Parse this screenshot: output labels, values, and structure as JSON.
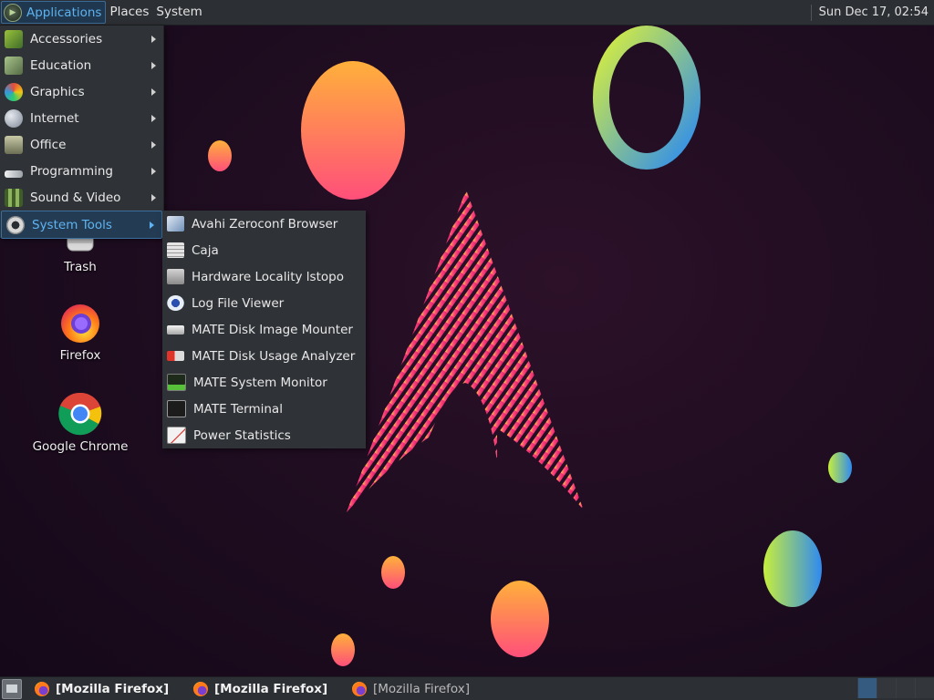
{
  "top_panel": {
    "applications_label": "Applications",
    "places_label": "Places",
    "system_label": "System",
    "clock": "Sun Dec 17, 02:54"
  },
  "app_menu": {
    "items": [
      {
        "label": "Accessories",
        "icon": "accessories-icon"
      },
      {
        "label": "Education",
        "icon": "education-icon"
      },
      {
        "label": "Graphics",
        "icon": "graphics-icon"
      },
      {
        "label": "Internet",
        "icon": "internet-icon"
      },
      {
        "label": "Office",
        "icon": "office-icon"
      },
      {
        "label": "Programming",
        "icon": "programming-icon"
      },
      {
        "label": "Sound & Video",
        "icon": "sound-video-icon"
      },
      {
        "label": "System Tools",
        "icon": "system-tools-icon",
        "active": true
      }
    ]
  },
  "system_tools_menu": {
    "items": [
      {
        "label": "Avahi Zeroconf Browser",
        "icon": "avahi-icon"
      },
      {
        "label": "Caja",
        "icon": "caja-icon"
      },
      {
        "label": "Hardware Locality lstopo",
        "icon": "hardware-icon"
      },
      {
        "label": "Log File Viewer",
        "icon": "log-viewer-icon"
      },
      {
        "label": "MATE Disk Image Mounter",
        "icon": "disk-mounter-icon"
      },
      {
        "label": "MATE Disk Usage Analyzer",
        "icon": "disk-usage-icon"
      },
      {
        "label": "MATE System Monitor",
        "icon": "system-monitor-icon"
      },
      {
        "label": "MATE Terminal",
        "icon": "terminal-icon"
      },
      {
        "label": "Power Statistics",
        "icon": "power-stats-icon"
      }
    ]
  },
  "desktop_icons": [
    {
      "label": "Trash",
      "icon": "trash-icon"
    },
    {
      "label": "Firefox",
      "icon": "firefox-icon"
    },
    {
      "label": "Google Chrome",
      "icon": "chrome-icon"
    }
  ],
  "taskbar": {
    "tasks": [
      {
        "label": "[Mozilla Firefox]",
        "state": "active"
      },
      {
        "label": "[Mozilla Firefox]",
        "state": "active"
      },
      {
        "label": "[Mozilla Firefox]",
        "state": "inactive"
      }
    ]
  },
  "colors": {
    "panel_bg": "#2c2f33",
    "menu_bg": "#2f3236",
    "highlight_text": "#5eb4f2",
    "wallpaper_bg": "#1d0c1f"
  }
}
